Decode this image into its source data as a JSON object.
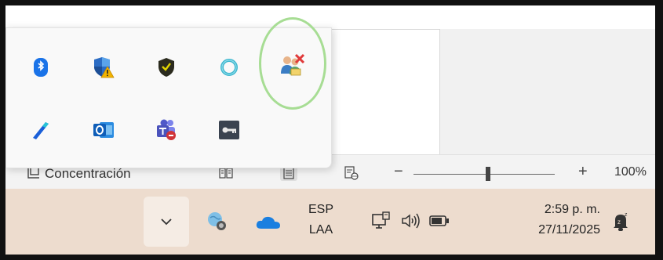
{
  "tray_popup": {
    "row1": [
      {
        "icon": "bluetooth-icon"
      },
      {
        "icon": "windows-security-warning-icon"
      },
      {
        "icon": "shield-check-icon"
      },
      {
        "icon": "ring-app-icon"
      },
      {
        "icon": "network-users-error-icon"
      }
    ],
    "row2": [
      {
        "icon": "pen-app-icon"
      },
      {
        "icon": "outlook-icon"
      },
      {
        "icon": "teams-icon"
      },
      {
        "icon": "key-icon"
      }
    ]
  },
  "statusbar": {
    "focus_label": "Concentración",
    "zoom_percent": "100%",
    "zoom_value": 100
  },
  "taskbar": {
    "lang_line1": "ESP",
    "lang_line2": "LAA",
    "time": "2:59 p. m.",
    "date": "27/11/2025"
  },
  "colors": {
    "taskbar_bg": "#eddcce",
    "highlight_ring": "#a7dd94",
    "onedrive_blue": "#1a7fe0"
  }
}
